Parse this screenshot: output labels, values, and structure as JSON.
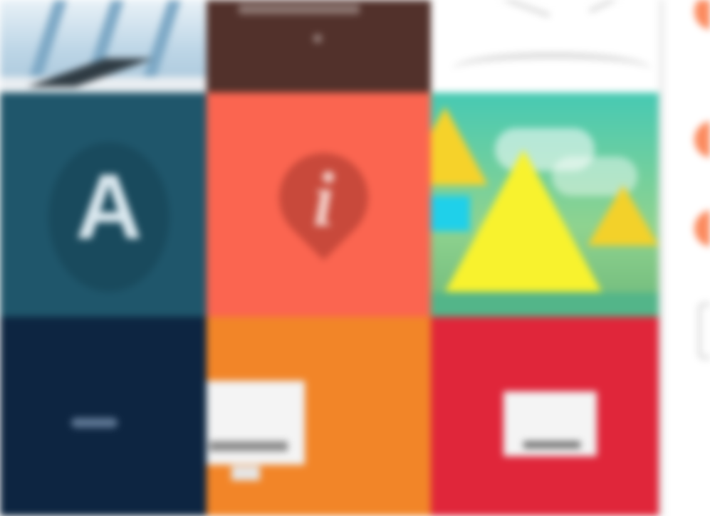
{
  "gallery": {
    "tiles": [
      {
        "id": "building-photo",
        "color": "#c7dbe8"
      },
      {
        "id": "brown-card",
        "color": "#52312b"
      },
      {
        "id": "white-sketch",
        "color": "#ffffff"
      },
      {
        "id": "teal-letter-app",
        "color": "#1f566b",
        "glyph": "A"
      },
      {
        "id": "coral-info-app",
        "color": "#fb6550",
        "glyph": "i"
      },
      {
        "id": "landscape-illustration",
        "color": "#46c9b3"
      },
      {
        "id": "navy-logo",
        "color": "#0d2541"
      },
      {
        "id": "orange-screen",
        "color": "#f28528"
      },
      {
        "id": "red-screen",
        "color": "#e0263a"
      }
    ]
  },
  "sidebar": {
    "accent": "#fb8a5e",
    "icons": [
      "avatar-circle",
      "avatar-circle",
      "avatar-circle",
      "rounded-box"
    ]
  }
}
